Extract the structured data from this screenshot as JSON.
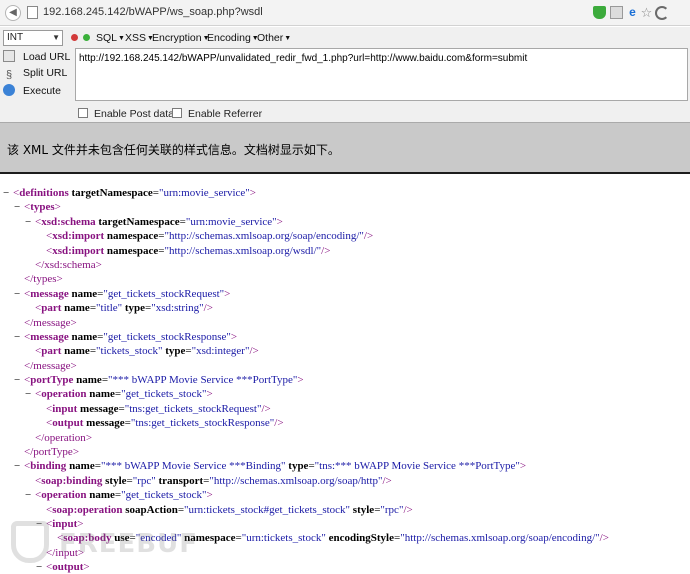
{
  "address_bar": {
    "url": "192.168.245.142/bWAPP/ws_soap.php?wsdl"
  },
  "hackbar": {
    "select_value": "INT",
    "menus": [
      "SQL",
      "XSS",
      "Encryption",
      "Encoding",
      "Other"
    ],
    "load_url": "Load URL",
    "split_url": "Split URL",
    "execute": "Execute",
    "url_value": "http://192.168.245.142/bWAPP/unvalidated_redir_fwd_1.php?url=http://www.baidu.com&form=submit",
    "enable_post": "Enable Post data",
    "enable_referrer": "Enable Referrer"
  },
  "notice": {
    "text": "该 XML 文件并未包含任何关联的样式信息。文档树显示如下。"
  },
  "xml_lines": [
    {
      "indent": 0,
      "toggle": "−",
      "parts": [
        [
          "br",
          "<"
        ],
        [
          "tg",
          "definitions"
        ],
        [
          "t",
          " "
        ],
        [
          "an",
          "targetNamespace"
        ],
        [
          "t",
          "="
        ],
        [
          "av",
          "\"urn:movie_service\""
        ],
        [
          "br",
          ">"
        ]
      ]
    },
    {
      "indent": 1,
      "toggle": "−",
      "parts": [
        [
          "br",
          "<"
        ],
        [
          "tg",
          "types"
        ],
        [
          "br",
          ">"
        ]
      ]
    },
    {
      "indent": 2,
      "toggle": "−",
      "parts": [
        [
          "br",
          "<"
        ],
        [
          "tg",
          "xsd:schema"
        ],
        [
          "t",
          " "
        ],
        [
          "an",
          "targetNamespace"
        ],
        [
          "t",
          "="
        ],
        [
          "av",
          "\"urn:movie_service\""
        ],
        [
          "br",
          ">"
        ]
      ]
    },
    {
      "indent": 3,
      "toggle": "",
      "parts": [
        [
          "br",
          "<"
        ],
        [
          "tg",
          "xsd:import"
        ],
        [
          "t",
          " "
        ],
        [
          "an",
          "namespace"
        ],
        [
          "t",
          "="
        ],
        [
          "av",
          "\"http://schemas.xmlsoap.org/soap/encoding/\""
        ],
        [
          "br",
          "/>"
        ]
      ]
    },
    {
      "indent": 3,
      "toggle": "",
      "parts": [
        [
          "br",
          "<"
        ],
        [
          "tg",
          "xsd:import"
        ],
        [
          "t",
          " "
        ],
        [
          "an",
          "namespace"
        ],
        [
          "t",
          "="
        ],
        [
          "av",
          "\"http://schemas.xmlsoap.org/wsdl/\""
        ],
        [
          "br",
          "/>"
        ]
      ]
    },
    {
      "indent": 2,
      "toggle": "",
      "parts": [
        [
          "br",
          "</"
        ],
        [
          "tgc",
          "xsd:schema"
        ],
        [
          "br",
          ">"
        ]
      ]
    },
    {
      "indent": 1,
      "toggle": "",
      "parts": [
        [
          "br",
          "</"
        ],
        [
          "tgc",
          "types"
        ],
        [
          "br",
          ">"
        ]
      ]
    },
    {
      "indent": 1,
      "toggle": "−",
      "parts": [
        [
          "br",
          "<"
        ],
        [
          "tg",
          "message"
        ],
        [
          "t",
          " "
        ],
        [
          "an",
          "name"
        ],
        [
          "t",
          "="
        ],
        [
          "av",
          "\"get_tickets_stockRequest\""
        ],
        [
          "br",
          ">"
        ]
      ]
    },
    {
      "indent": 2,
      "toggle": "",
      "parts": [
        [
          "br",
          "<"
        ],
        [
          "tg",
          "part"
        ],
        [
          "t",
          " "
        ],
        [
          "an",
          "name"
        ],
        [
          "t",
          "="
        ],
        [
          "av",
          "\"title\""
        ],
        [
          "t",
          " "
        ],
        [
          "an",
          "type"
        ],
        [
          "t",
          "="
        ],
        [
          "av",
          "\"xsd:string\""
        ],
        [
          "br",
          "/>"
        ]
      ]
    },
    {
      "indent": 1,
      "toggle": "",
      "parts": [
        [
          "br",
          "</"
        ],
        [
          "tgc",
          "message"
        ],
        [
          "br",
          ">"
        ]
      ]
    },
    {
      "indent": 1,
      "toggle": "−",
      "parts": [
        [
          "br",
          "<"
        ],
        [
          "tg",
          "message"
        ],
        [
          "t",
          " "
        ],
        [
          "an",
          "name"
        ],
        [
          "t",
          "="
        ],
        [
          "av",
          "\"get_tickets_stockResponse\""
        ],
        [
          "br",
          ">"
        ]
      ]
    },
    {
      "indent": 2,
      "toggle": "",
      "parts": [
        [
          "br",
          "<"
        ],
        [
          "tg",
          "part"
        ],
        [
          "t",
          " "
        ],
        [
          "an",
          "name"
        ],
        [
          "t",
          "="
        ],
        [
          "av",
          "\"tickets_stock\""
        ],
        [
          "t",
          " "
        ],
        [
          "an",
          "type"
        ],
        [
          "t",
          "="
        ],
        [
          "av",
          "\"xsd:integer\""
        ],
        [
          "br",
          "/>"
        ]
      ]
    },
    {
      "indent": 1,
      "toggle": "",
      "parts": [
        [
          "br",
          "</"
        ],
        [
          "tgc",
          "message"
        ],
        [
          "br",
          ">"
        ]
      ]
    },
    {
      "indent": 1,
      "toggle": "−",
      "parts": [
        [
          "br",
          "<"
        ],
        [
          "tg",
          "portType"
        ],
        [
          "t",
          " "
        ],
        [
          "an",
          "name"
        ],
        [
          "t",
          "="
        ],
        [
          "av",
          "\"*** bWAPP Movie Service ***PortType\""
        ],
        [
          "br",
          ">"
        ]
      ]
    },
    {
      "indent": 2,
      "toggle": "−",
      "parts": [
        [
          "br",
          "<"
        ],
        [
          "tg",
          "operation"
        ],
        [
          "t",
          " "
        ],
        [
          "an",
          "name"
        ],
        [
          "t",
          "="
        ],
        [
          "av",
          "\"get_tickets_stock\""
        ],
        [
          "br",
          ">"
        ]
      ]
    },
    {
      "indent": 3,
      "toggle": "",
      "parts": [
        [
          "br",
          "<"
        ],
        [
          "tg",
          "input"
        ],
        [
          "t",
          " "
        ],
        [
          "an",
          "message"
        ],
        [
          "t",
          "="
        ],
        [
          "av",
          "\"tns:get_tickets_stockRequest\""
        ],
        [
          "br",
          "/>"
        ]
      ]
    },
    {
      "indent": 3,
      "toggle": "",
      "parts": [
        [
          "br",
          "<"
        ],
        [
          "tg",
          "output"
        ],
        [
          "t",
          " "
        ],
        [
          "an",
          "message"
        ],
        [
          "t",
          "="
        ],
        [
          "av",
          "\"tns:get_tickets_stockResponse\""
        ],
        [
          "br",
          "/>"
        ]
      ]
    },
    {
      "indent": 2,
      "toggle": "",
      "parts": [
        [
          "br",
          "</"
        ],
        [
          "tgc",
          "operation"
        ],
        [
          "br",
          ">"
        ]
      ]
    },
    {
      "indent": 1,
      "toggle": "",
      "parts": [
        [
          "br",
          "</"
        ],
        [
          "tgc",
          "portType"
        ],
        [
          "br",
          ">"
        ]
      ]
    },
    {
      "indent": 1,
      "toggle": "−",
      "parts": [
        [
          "br",
          "<"
        ],
        [
          "tg",
          "binding"
        ],
        [
          "t",
          " "
        ],
        [
          "an",
          "name"
        ],
        [
          "t",
          "="
        ],
        [
          "av",
          "\"*** bWAPP Movie Service ***Binding\""
        ],
        [
          "t",
          " "
        ],
        [
          "an",
          "type"
        ],
        [
          "t",
          "="
        ],
        [
          "av",
          "\"tns:*** bWAPP Movie Service ***PortType\""
        ],
        [
          "br",
          ">"
        ]
      ]
    },
    {
      "indent": 2,
      "toggle": "",
      "parts": [
        [
          "br",
          "<"
        ],
        [
          "tg",
          "soap:binding"
        ],
        [
          "t",
          " "
        ],
        [
          "an",
          "style"
        ],
        [
          "t",
          "="
        ],
        [
          "av",
          "\"rpc\""
        ],
        [
          "t",
          " "
        ],
        [
          "an",
          "transport"
        ],
        [
          "t",
          "="
        ],
        [
          "av",
          "\"http://schemas.xmlsoap.org/soap/http\""
        ],
        [
          "br",
          "/>"
        ]
      ]
    },
    {
      "indent": 2,
      "toggle": "−",
      "parts": [
        [
          "br",
          "<"
        ],
        [
          "tg",
          "operation"
        ],
        [
          "t",
          " "
        ],
        [
          "an",
          "name"
        ],
        [
          "t",
          "="
        ],
        [
          "av",
          "\"get_tickets_stock\""
        ],
        [
          "br",
          ">"
        ]
      ]
    },
    {
      "indent": 3,
      "toggle": "",
      "parts": [
        [
          "br",
          "<"
        ],
        [
          "tg",
          "soap:operation"
        ],
        [
          "t",
          " "
        ],
        [
          "an",
          "soapAction"
        ],
        [
          "t",
          "="
        ],
        [
          "av",
          "\"urn:tickets_stock#get_tickets_stock\""
        ],
        [
          "t",
          " "
        ],
        [
          "an",
          "style"
        ],
        [
          "t",
          "="
        ],
        [
          "av",
          "\"rpc\""
        ],
        [
          "br",
          "/>"
        ]
      ]
    },
    {
      "indent": 3,
      "toggle": "−",
      "parts": [
        [
          "br",
          "<"
        ],
        [
          "tg",
          "input"
        ],
        [
          "br",
          ">"
        ]
      ]
    },
    {
      "indent": 4,
      "toggle": "",
      "parts": [
        [
          "br",
          "<"
        ],
        [
          "tg",
          "soap:body"
        ],
        [
          "t",
          " "
        ],
        [
          "an",
          "use"
        ],
        [
          "t",
          "="
        ],
        [
          "av",
          "\"encoded\""
        ],
        [
          "t",
          " "
        ],
        [
          "an",
          "namespace"
        ],
        [
          "t",
          "="
        ],
        [
          "av",
          "\"urn:tickets_stock\""
        ],
        [
          "t",
          " "
        ],
        [
          "an",
          "encodingStyle"
        ],
        [
          "t",
          "="
        ],
        [
          "av",
          "\"http://schemas.xmlsoap.org/soap/encoding/\""
        ],
        [
          "br",
          "/>"
        ]
      ]
    },
    {
      "indent": 3,
      "toggle": "",
      "parts": [
        [
          "br",
          "</"
        ],
        [
          "tgc",
          "input"
        ],
        [
          "br",
          ">"
        ]
      ]
    },
    {
      "indent": 3,
      "toggle": "−",
      "parts": [
        [
          "br",
          "<"
        ],
        [
          "tg",
          "output"
        ],
        [
          "br",
          ">"
        ]
      ]
    }
  ]
}
